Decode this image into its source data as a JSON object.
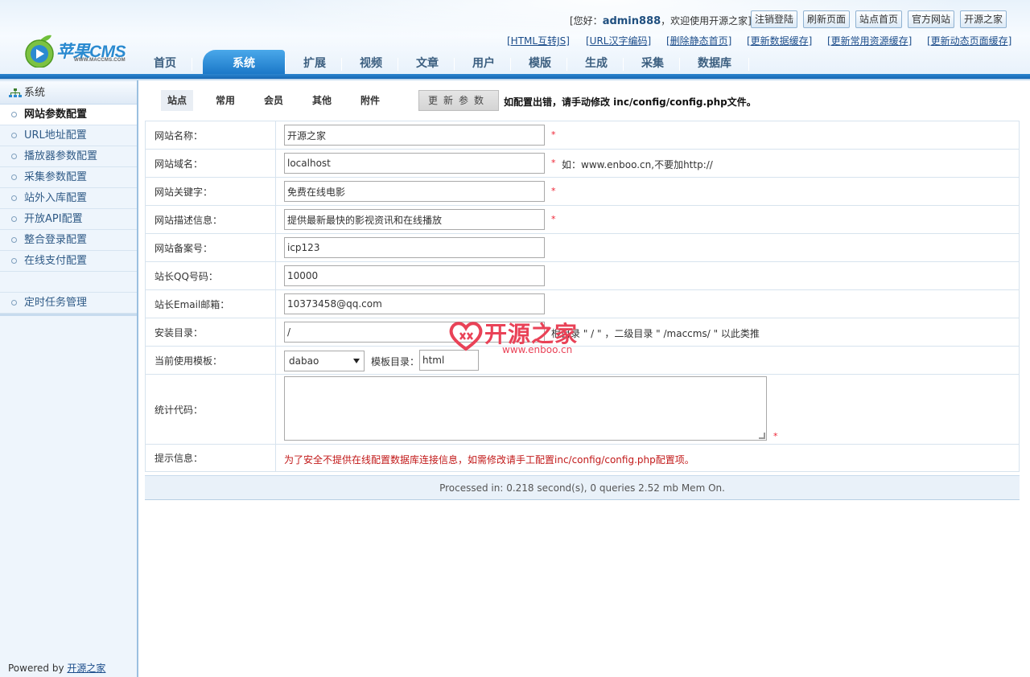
{
  "header": {
    "brand": "苹果CMS",
    "brand_sub": "WWW.MACCMS.COM",
    "welcome_prefix": "[您好：",
    "username": "admin888",
    "welcome_suffix": "，欢迎使用开源之家]",
    "buttons": [
      "注销登陆",
      "刷新页面",
      "站点首页",
      "官方网站",
      "开源之家"
    ],
    "quick_links": [
      "[HTML互转JS]",
      "[URL汉字编码]",
      "[删除静态首页]",
      "[更新数据缓存]",
      "[更新常用资源缓存]",
      "[更新动态页面缓存]"
    ],
    "nav": [
      "首页",
      "系统",
      "扩展",
      "视频",
      "文章",
      "用户",
      "模版",
      "生成",
      "采集",
      "数据库"
    ],
    "nav_active": "系统"
  },
  "sidebar": {
    "title": "系统",
    "items": [
      "网站参数配置",
      "URL地址配置",
      "播放器参数配置",
      "采集参数配置",
      "站外入库配置",
      "开放API配置",
      "整合登录配置",
      "在线支付配置"
    ],
    "current": "网站参数配置",
    "extra_items": [
      "定时任务管理"
    ],
    "powered_prefix": "Powered by ",
    "powered_link": "开源之家"
  },
  "subtabs": [
    "站点",
    "常用",
    "会员",
    "其他",
    "附件"
  ],
  "subtab_active": "站点",
  "update_button": "更新参数",
  "update_tip": "如配置出错，请手动修改 inc/config/config.php文件。",
  "form": {
    "site_name": {
      "label": "网站名称：",
      "value": "开源之家"
    },
    "site_domain": {
      "label": "网站域名：",
      "value": "localhost",
      "hint": "如：www.enboo.cn,不要加http://"
    },
    "site_keywords": {
      "label": "网站关键字：",
      "value": "免费在线电影"
    },
    "site_description": {
      "label": "网站描述信息：",
      "value": "提供最新最快的影视资讯和在线播放"
    },
    "site_icp": {
      "label": "网站备案号：",
      "value": "icp123"
    },
    "admin_qq": {
      "label": "站长QQ号码：",
      "value": "10000"
    },
    "admin_email": {
      "label": "站长Email邮箱：",
      "value": "10373458@qq.com"
    },
    "install_dir": {
      "label": "安装目录：",
      "value": "/",
      "hint": "根目录 \" / \" ，二级目录 \" /maccms/ \" 以此类推"
    },
    "template": {
      "label": "当前使用模板：",
      "value": "dabao",
      "dir_label": "模板目录：",
      "dir_value": "html"
    },
    "stats_code": {
      "label": "统计代码："
    },
    "notice": {
      "label": "提示信息：",
      "text": "为了安全不提供在线配置数据库连接信息，如需修改请手工配置inc/config/config.php配置项。"
    }
  },
  "required_mark": "*",
  "footer": "Processed in: 0.218 second(s), 0 queries 2.52 mb Mem On.",
  "watermark": {
    "text": "开源之家",
    "url": "www.enboo.cn"
  }
}
